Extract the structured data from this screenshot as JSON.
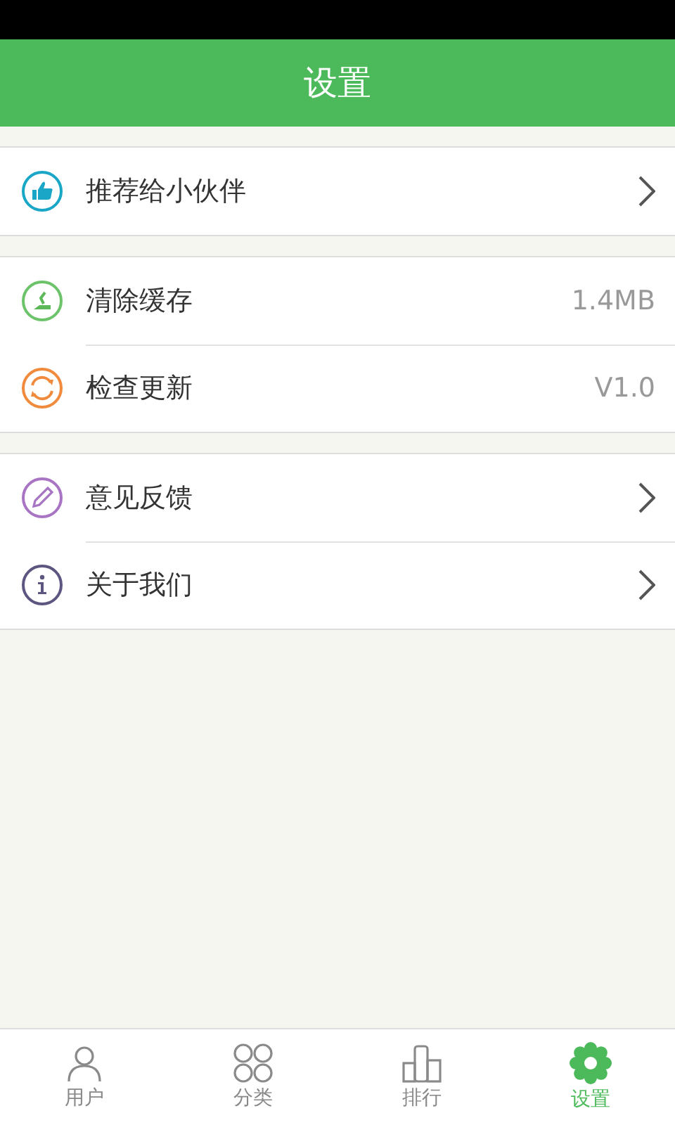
{
  "header": {
    "title": "设置"
  },
  "groups": [
    {
      "rows": [
        {
          "label": "推荐给小伙伴",
          "kind": "link"
        }
      ]
    },
    {
      "rows": [
        {
          "label": "清除缓存",
          "kind": "value",
          "value": "1.4MB"
        },
        {
          "label": "检查更新",
          "kind": "value",
          "value": "V1.0"
        }
      ]
    },
    {
      "rows": [
        {
          "label": "意见反馈",
          "kind": "link"
        },
        {
          "label": "关于我们",
          "kind": "link"
        }
      ]
    }
  ],
  "tabs": [
    {
      "label": "用户",
      "selected": false
    },
    {
      "label": "分类",
      "selected": false
    },
    {
      "label": "排行",
      "selected": false
    },
    {
      "label": "设置",
      "selected": true
    }
  ]
}
